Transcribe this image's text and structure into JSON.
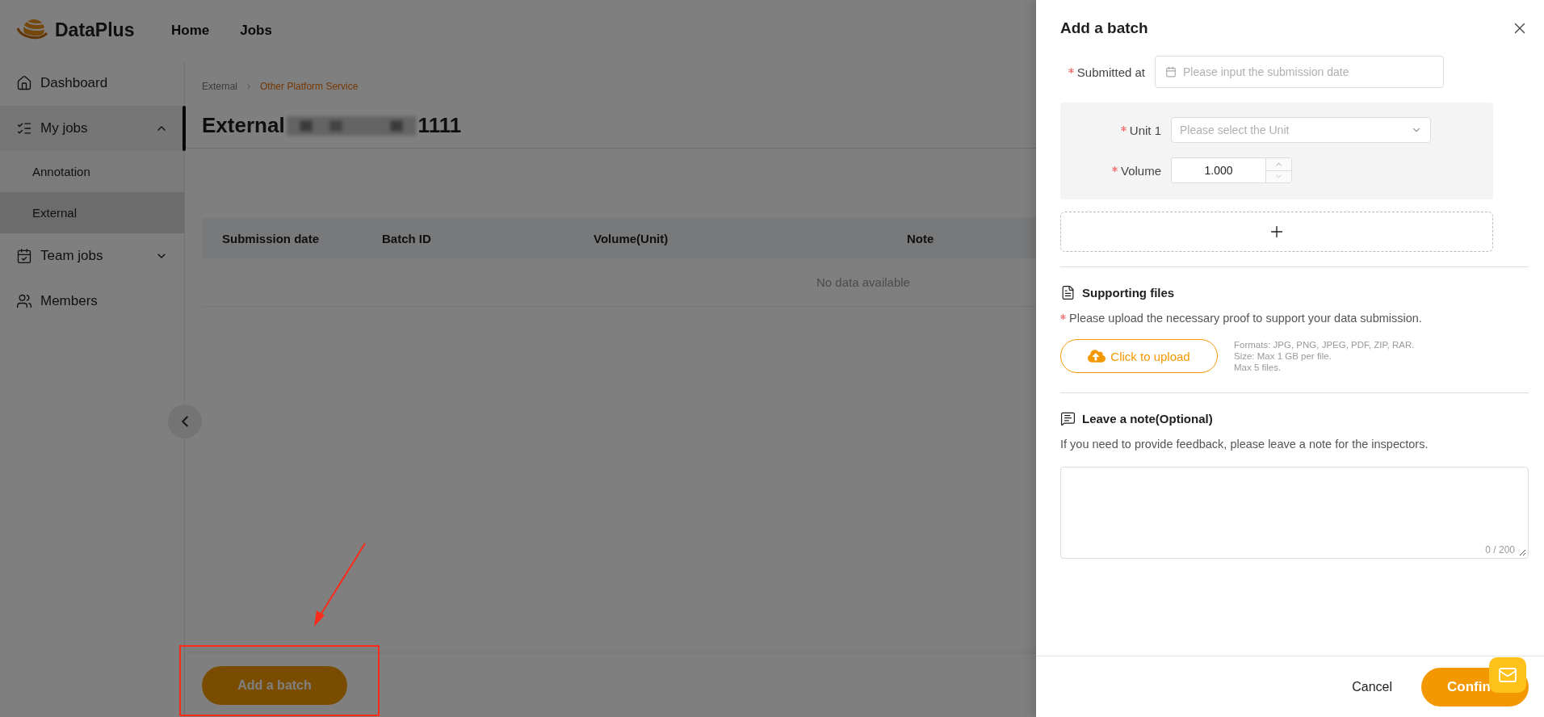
{
  "header": {
    "logo": "DataPlus",
    "nav": [
      {
        "label": "Home"
      },
      {
        "label": "Jobs"
      }
    ]
  },
  "sidebar": {
    "items": [
      {
        "label": "Dashboard",
        "selected": false
      },
      {
        "label": "My jobs",
        "selected": true,
        "expanded": true,
        "children": [
          {
            "label": "Annotation",
            "selected": false
          },
          {
            "label": "External",
            "selected": true
          }
        ]
      },
      {
        "label": "Team jobs",
        "selected": false,
        "expanded": false
      },
      {
        "label": "Members",
        "selected": false
      }
    ]
  },
  "breadcrumb": [
    "External",
    "Other Platform Service"
  ],
  "page_title": {
    "text": "External",
    "suffix": "1111"
  },
  "table": {
    "columns": [
      "Submission date",
      "Batch ID",
      "Volume(Unit)",
      "Note"
    ],
    "empty_text": "No data available"
  },
  "footer": {
    "button": "Add a batch"
  },
  "drawer": {
    "title": "Add a batch",
    "submitted": {
      "label": "Submitted at",
      "required": true,
      "placeholder": "Please input the submission date"
    },
    "unit": {
      "label": "Unit 1",
      "required": true,
      "placeholder": "Please select the Unit"
    },
    "volume": {
      "label": "Volume",
      "required": true,
      "value": "1.000"
    },
    "files": {
      "heading": "Supporting files",
      "required": true,
      "text": "Please upload the necessary proof to support your data submission.",
      "button": "Click to upload",
      "hints": [
        "Formats: JPG, PNG, JPEG, PDF, ZIP, RAR.",
        "Size: Max 1 GB per file.",
        "Max 5 files."
      ]
    },
    "note": {
      "heading": "Leave a note(Optional)",
      "text": "If you need to provide feedback, please leave a note for the inspectors.",
      "counter": "0 / 200"
    },
    "cancel": "Cancel",
    "confirm": "Confin"
  }
}
